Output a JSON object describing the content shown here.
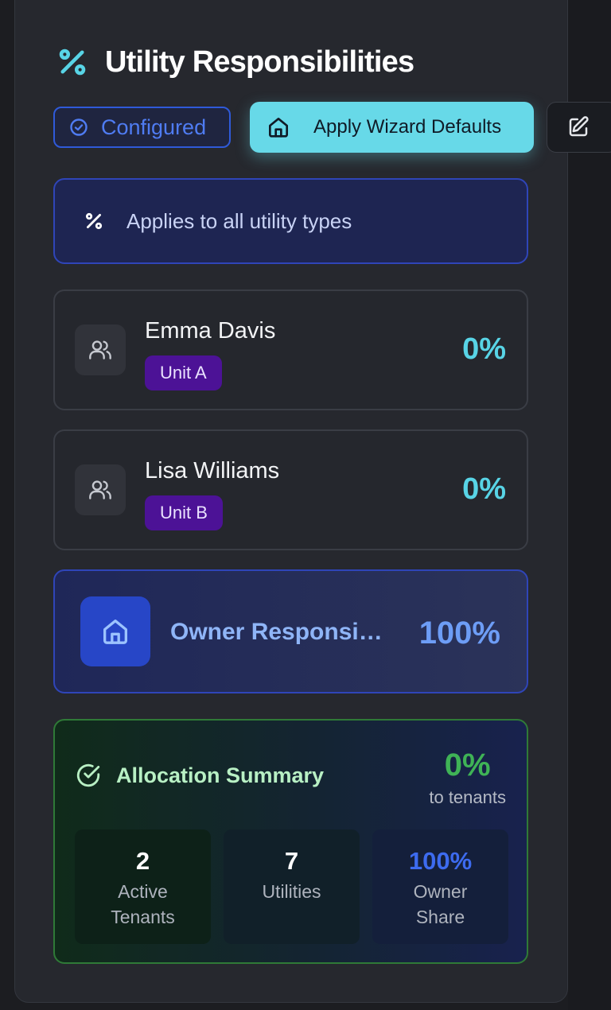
{
  "header": {
    "title": "Utility Responsibilities",
    "icon": "percent-icon"
  },
  "status": {
    "label": "Configured",
    "icon": "check-circle-icon"
  },
  "actions": {
    "apply_defaults_label": "Apply Wizard Defaults",
    "apply_defaults_icon": "home-icon",
    "edit_icon": "edit-icon"
  },
  "info": {
    "text": "Applies to all utility types",
    "icon": "percent-icon"
  },
  "tenants": [
    {
      "name": "Emma Davis",
      "unit": "Unit A",
      "percentage": "0%",
      "icon": "users-icon"
    },
    {
      "name": "Lisa Williams",
      "unit": "Unit B",
      "percentage": "0%",
      "icon": "users-icon"
    }
  ],
  "owner": {
    "label": "Owner Responsibility",
    "percentage": "100%",
    "icon": "home-icon"
  },
  "summary": {
    "title": "Allocation Summary",
    "icon": "check-circle-icon",
    "tenant_percentage": "0%",
    "tenant_percentage_label": "to tenants",
    "stats": [
      {
        "value": "2",
        "label": "Active Tenants"
      },
      {
        "value": "7",
        "label": "Utilities"
      },
      {
        "value": "100%",
        "label": "Owner Share"
      }
    ]
  },
  "colors": {
    "accent_cyan": "#67d9e8",
    "accent_blue": "#2f5ad9",
    "accent_green": "#3fb356",
    "unit_badge": "#4c1296"
  }
}
